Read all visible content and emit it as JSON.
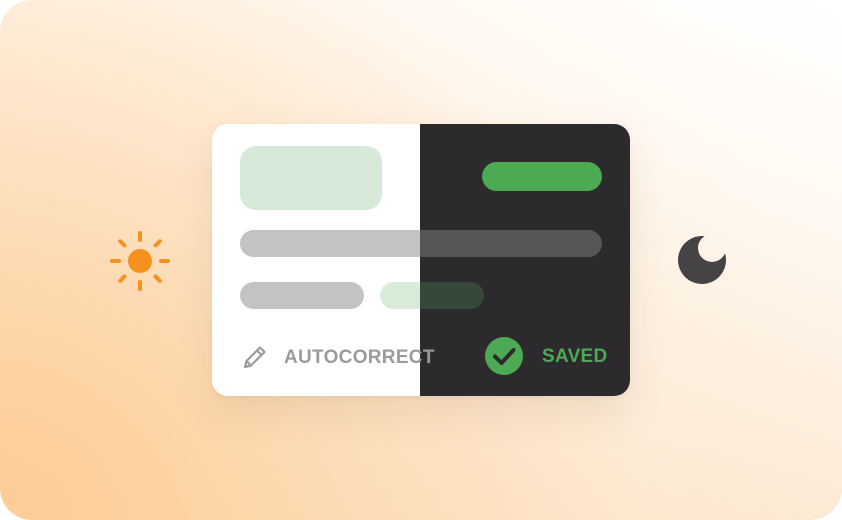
{
  "illustration": {
    "light_mode_icon": "sun-icon",
    "dark_mode_icon": "moon-icon",
    "colors": {
      "accent_orange": "#f5921e",
      "moon_gray": "#454345",
      "success_green": "#4caa55",
      "light_panel": "#ffffff",
      "dark_panel": "#2c2a2c",
      "placeholder_gray": "#c4c2c5",
      "placeholder_green": "#d6e9d8"
    }
  },
  "card": {
    "autocorrect": {
      "icon": "pencil-icon",
      "label": "AUTOCORRECT"
    },
    "status": {
      "icon": "check-circle-icon",
      "label": "SAVED"
    }
  }
}
